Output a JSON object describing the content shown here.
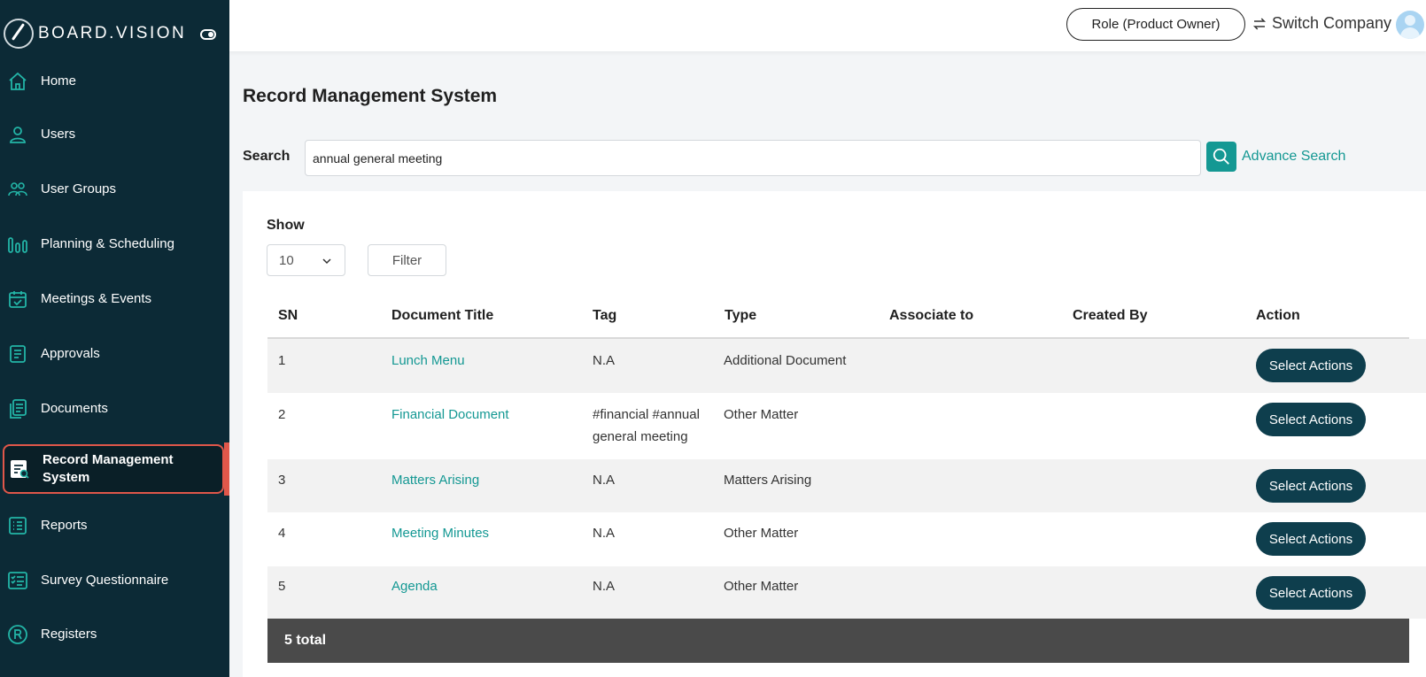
{
  "brand": {
    "name": "BOARD.VISION"
  },
  "sidebar": {
    "items": [
      {
        "label": "Home",
        "icon": "home-icon"
      },
      {
        "label": "Users",
        "icon": "user-icon"
      },
      {
        "label": "User Groups",
        "icon": "users-icon"
      },
      {
        "label": "Planning & Scheduling",
        "icon": "chart-bars-icon"
      },
      {
        "label": "Meetings & Events",
        "icon": "calendar-check-icon"
      },
      {
        "label": "Approvals",
        "icon": "document-icon"
      },
      {
        "label": "Documents",
        "icon": "documents-icon"
      },
      {
        "label": "Record Management System",
        "icon": "record-search-icon",
        "active": true
      },
      {
        "label": "Reports",
        "icon": "list-icon"
      },
      {
        "label": "Survey Questionnaire",
        "icon": "checklist-icon"
      },
      {
        "label": "Registers",
        "icon": "registered-icon"
      }
    ]
  },
  "header": {
    "role": "Role (Product Owner)",
    "switch_company": "Switch Company"
  },
  "main": {
    "title": "Record Management System",
    "search_label": "Search",
    "search_value": "annual general meeting",
    "advance_search": "Advance Search",
    "show_label": "Show",
    "page_size": "10",
    "filter_label": "Filter"
  },
  "table": {
    "columns": [
      "SN",
      "Document Title",
      "Tag",
      "Type",
      "Associate to",
      "Created By",
      "Action"
    ],
    "rows": [
      {
        "sn": "1",
        "title": "Lunch Menu",
        "tag": "N.A",
        "type": "Additional Document",
        "associate": "",
        "created_by": "",
        "action": "Select Actions"
      },
      {
        "sn": "2",
        "title": "Financial Document",
        "tag": "#financial #annual general meeting",
        "type": "Other Matter",
        "associate": "",
        "created_by": "",
        "action": "Select Actions"
      },
      {
        "sn": "3",
        "title": "Matters Arising",
        "tag": "N.A",
        "type": "Matters Arising",
        "associate": "",
        "created_by": "",
        "action": "Select Actions"
      },
      {
        "sn": "4",
        "title": "Meeting Minutes",
        "tag": "N.A",
        "type": "Other Matter",
        "associate": "",
        "created_by": "",
        "action": "Select Actions"
      },
      {
        "sn": "5",
        "title": "Agenda",
        "tag": "N.A",
        "type": "Other Matter",
        "associate": "",
        "created_by": "",
        "action": "Select Actions"
      }
    ],
    "footer": "5 total"
  },
  "colors": {
    "sidebar_bg": "#0c2a36",
    "accent": "#149893",
    "active_outline": "#e0574a",
    "action_button": "#0e3e4d"
  }
}
